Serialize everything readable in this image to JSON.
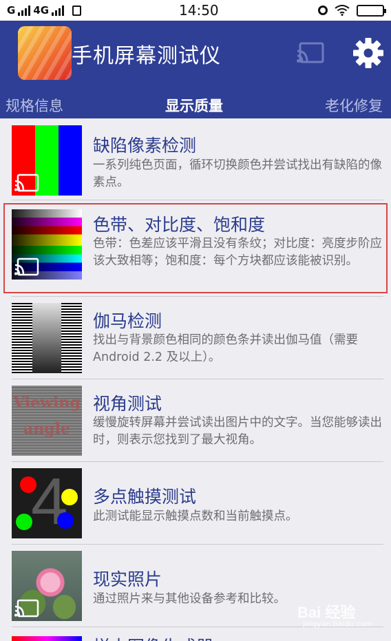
{
  "status_bar": {
    "carrier_1": "G",
    "carrier_2": "4G",
    "time": "14:50"
  },
  "header": {
    "title": "手机屏幕测试仪",
    "icons": [
      "cast-icon",
      "gear-icon"
    ],
    "background_color": "#2f3f95"
  },
  "tabs": [
    {
      "label": "规格信息",
      "selected": false
    },
    {
      "label": "显示质量",
      "selected": true
    },
    {
      "label": "老化修复",
      "selected": false
    }
  ],
  "list": {
    "items": [
      {
        "title": "缺陷像素检测",
        "desc": "一系列纯色页面，循环切换颜色并尝试找出有缺陷的像素点。",
        "thumb": "rgb-bars"
      },
      {
        "title": "色带、对比度、饱和度",
        "desc": "色带：色差应该平滑且没有条纹；对比度：亮度步阶应该大致相等；饱和度：每个方块都应该能被识别。",
        "thumb": "color-bands",
        "highlighted": true
      },
      {
        "title": "伽马检测",
        "desc": "找出与背景颜色相同的颜色条并读出伽马值（需要 Android 2.2 及以上）。",
        "thumb": "gamma-stripes"
      },
      {
        "title": "视角测试",
        "desc": "缓慢旋转屏幕并尝试读出图片中的文字。当您能够读出时，则表示您找到了最大视角。",
        "thumb": "viewing-angle",
        "thumb_text": [
          "Viewing",
          "angle"
        ]
      },
      {
        "title": "多点触摸测试",
        "desc": "此测试能显示触摸点数和当前触摸点。",
        "thumb": "multitouch",
        "thumb_text": "4"
      },
      {
        "title": "现实照片",
        "desc": "通过照片来与其他设备参考和比较。",
        "thumb": "photo"
      },
      {
        "title": "样本图像生成器",
        "desc": "",
        "thumb": "partial"
      }
    ]
  },
  "watermark": {
    "text": "Bai 经验",
    "sub": "jingyan.baidu.com"
  },
  "colors": {
    "title_text": "#2b3b8c",
    "highlight_border": "#d64545"
  }
}
